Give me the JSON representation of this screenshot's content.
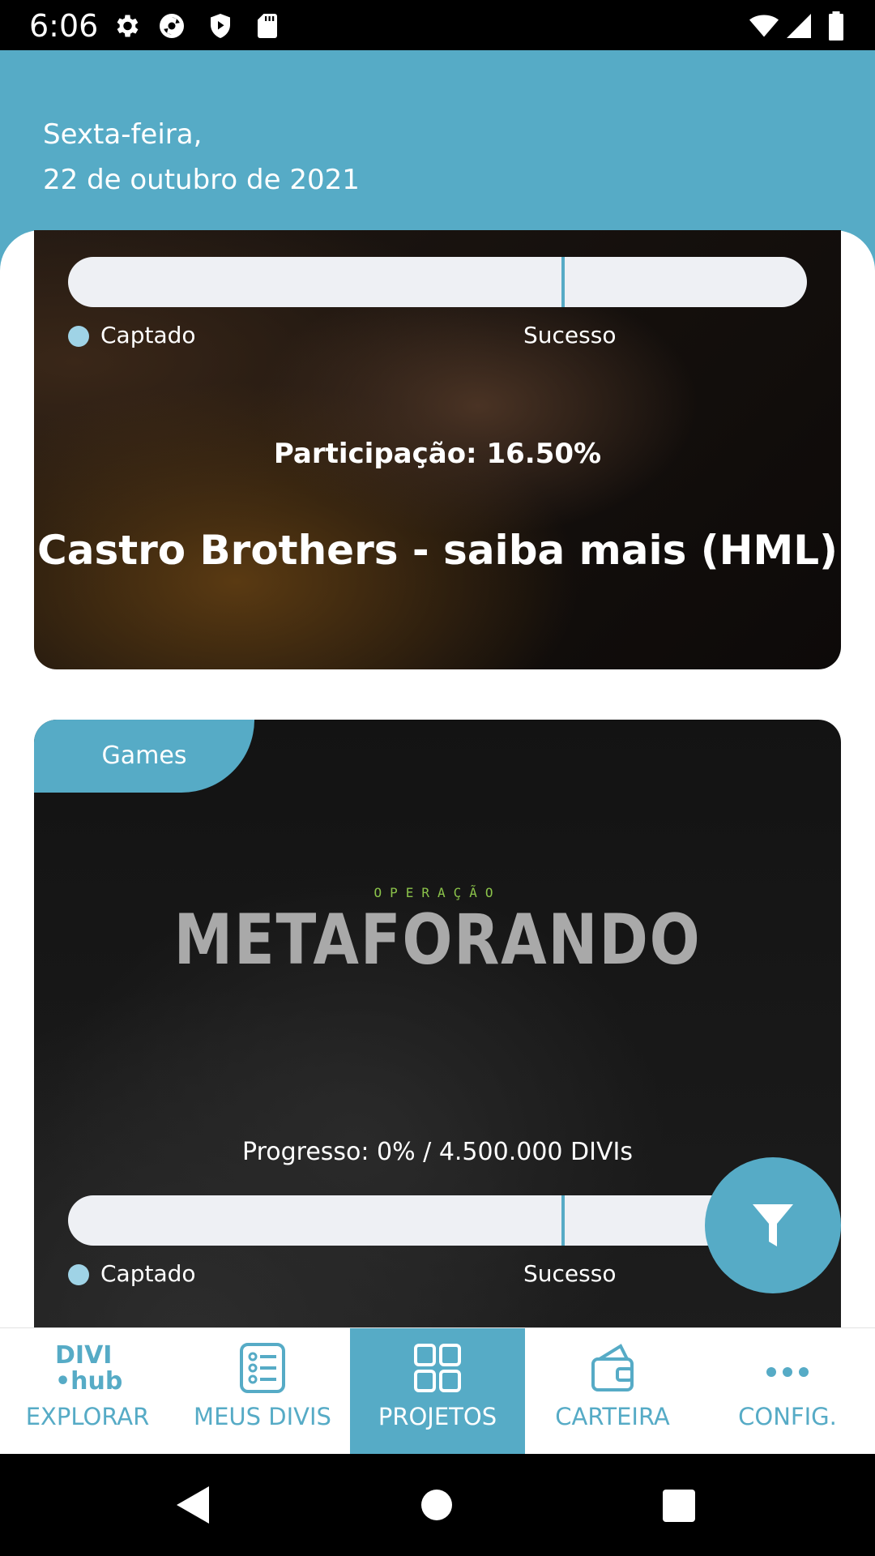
{
  "status_bar": {
    "time": "6:06",
    "icons": [
      "gear-icon",
      "sync-icon",
      "shield-play-icon",
      "sd-card-icon",
      "wifi-icon",
      "signal-icon",
      "battery-icon"
    ]
  },
  "header": {
    "date_line1": "Sexta-feira,",
    "date_line2": "22 de outubro de 2021"
  },
  "cards": [
    {
      "legend_captado": "Captado",
      "legend_sucesso": "Sucesso",
      "participation": "Participação: 16.50%",
      "title": "Castro Brothers - saiba mais (HML)"
    },
    {
      "category": "Games",
      "logo_sub": "OPERAÇÃO",
      "logo_main": "METAFORANDO",
      "progress": "Progresso: 0% / 4.500.000 DIVIs",
      "legend_captado": "Captado",
      "legend_sucesso": "Sucesso"
    }
  ],
  "fab": {
    "icon": "filter-icon"
  },
  "bottom_nav": {
    "items": [
      {
        "label": "EXPLORAR",
        "icon": "divihub-logo",
        "logo_line1": "DIVI",
        "logo_line2": "•hub"
      },
      {
        "label": "MEUS DIVIS",
        "icon": "list-icon"
      },
      {
        "label": "PROJETOS",
        "icon": "grid-icon",
        "active": true
      },
      {
        "label": "CARTEIRA",
        "icon": "wallet-icon"
      },
      {
        "label": "CONFIG.",
        "icon": "more-icon"
      }
    ]
  },
  "colors": {
    "accent": "#56abc6",
    "legend_dot": "#9fd3e6",
    "track": "#eef0f4"
  }
}
